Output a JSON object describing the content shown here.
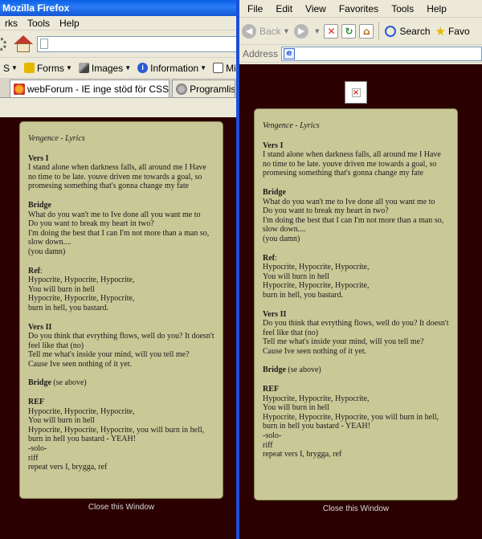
{
  "firefox": {
    "title": "Mozilla Firefox",
    "menu": [
      "rks",
      "Tools",
      "Help"
    ],
    "devbar": {
      "partial": "S",
      "forms": "Forms",
      "images": "Images",
      "information": "Information",
      "misc": "Miscell"
    },
    "tabs": [
      "webForum - IE inge stöd för CSS s...",
      "Programlist"
    ]
  },
  "ie": {
    "menu": [
      "File",
      "Edit",
      "View",
      "Favorites",
      "Tools",
      "Help"
    ],
    "toolbar": {
      "back": "Back",
      "search": "Search",
      "favorites": "Favo"
    },
    "address_label": "Address"
  },
  "song": {
    "title": "Vengence - Lyrics",
    "sections": [
      {
        "title": "Vers I",
        "lines": [
          "I stand alone when darkness falls, all around me I Have no time to be late. youve driven me towards a goal, so promesing something that's gonna change my fate"
        ]
      },
      {
        "title": "Bridge",
        "lines": [
          "What do you wan't me to Ive done all you want me to",
          "Do you want to break my heart in two?",
          "I'm doing the best that I can I'm not more than a man so, slow down....",
          "(you damn)"
        ]
      },
      {
        "title": "Ref",
        "suffix": ":",
        "lines": [
          "Hypocrite, Hypocrite, Hypocrite,",
          "You will burn in hell",
          "Hypocrite, Hypocrite, Hypocrite,",
          "burn in hell, you bastard."
        ]
      },
      {
        "title": "Vers II",
        "lines": [
          "Do you think that evrything flows, well do you? It doesn't feel like that (no)",
          "Tell me what's inside your mind, will you tell me?",
          "Cause Ive seen nothing of it yet."
        ]
      },
      {
        "title": "Bridge",
        "note": "(se above)",
        "lines": []
      },
      {
        "title": "REF",
        "lines": [
          "Hypocrite, Hypocrite, Hypocrite,",
          "You will burn in hell",
          "Hypocrite, Hypocrite, Hypocrite, you will burn in hell, burn in hell you bastard - YEAH!",
          "-solo-",
          "riff",
          "repeat vers I, brygga, ref"
        ]
      }
    ]
  },
  "close_link": "Close this Window",
  "colors": {
    "page_bg": "#2b0000",
    "box_bg": "#c9c897",
    "xp_blue": "#1c4fd8"
  }
}
